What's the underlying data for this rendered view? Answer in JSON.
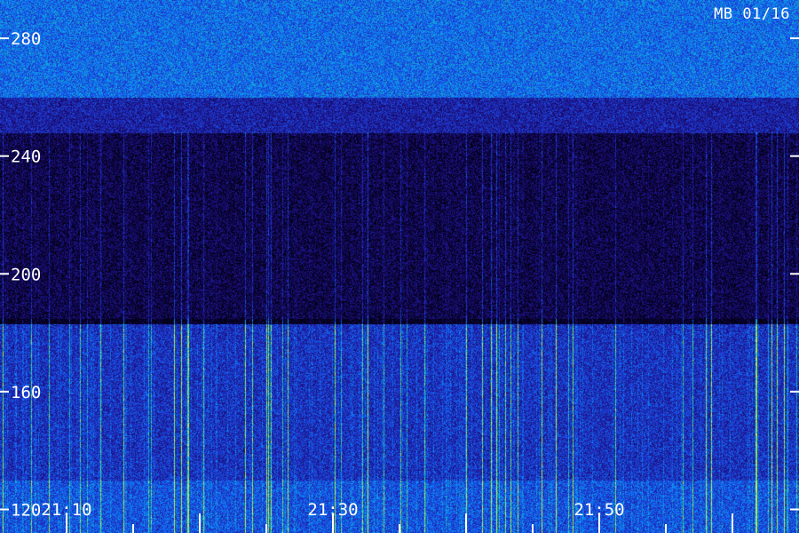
{
  "station_label": "MB 01/16",
  "chart_data": {
    "type": "heatmap",
    "title": "",
    "xlabel": "",
    "ylabel": "",
    "y_ticks": [
      "280",
      "240",
      "200",
      "160",
      "120"
    ],
    "y_tick_values": [
      280,
      240,
      200,
      160,
      120
    ],
    "ylim": [
      112,
      293
    ],
    "x_tick_labels": [
      "21:10",
      "21:30",
      "21:50"
    ],
    "x_range": [
      "21:05",
      "22:05"
    ],
    "minor_tick_interval_minutes": 5,
    "colormap": [
      "#000010",
      "#1a0a6e",
      "#2030c8",
      "#0a80ff",
      "#20d0a0",
      "#c0ff40"
    ],
    "bands": [
      {
        "y_from": 260,
        "y_to": 293,
        "level": 0.55
      },
      {
        "y_from": 248,
        "y_to": 260,
        "level": 0.32
      },
      {
        "y_from": 185,
        "y_to": 248,
        "level": 0.12
      },
      {
        "y_from": 183,
        "y_to": 185,
        "level": 0.0
      },
      {
        "y_from": 130,
        "y_to": 183,
        "level": 0.38
      },
      {
        "y_from": 112,
        "y_to": 130,
        "level": 0.48
      }
    ],
    "grid": false,
    "legend": "none"
  }
}
